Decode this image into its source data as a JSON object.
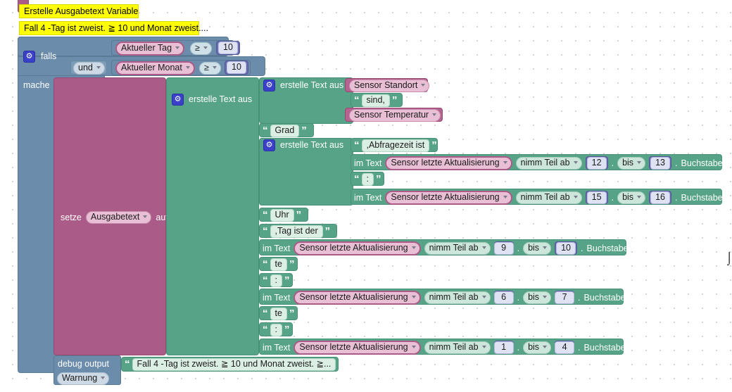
{
  "app": {
    "kind": "blockly-workspace",
    "language": "de",
    "background": "#ffffff",
    "grid_dot_color": "#cfcfcf"
  },
  "colors": {
    "control_blue": "#6b8cab",
    "variable_magenta": "#ab5b87",
    "text_green": "#56a387",
    "math_purple": "#6a6cb0",
    "logic_lightblue": "#7d9cb8",
    "comment_yellow": "#ffff00",
    "gear_icon_blue": "#3a40c8"
  },
  "comments": [
    {
      "text": "Erstelle Ausgabetext Variable"
    },
    {
      "text": "Fall 4 -Tag ist zweist. ≧ 10 und Monat zweist...."
    }
  ],
  "control": {
    "gear_icon": "gear-icon",
    "if_label": "falls",
    "do_label": "mache",
    "and_operator": "und"
  },
  "conditions": [
    {
      "variable": "Aktueller Tag",
      "operator": "≥",
      "value": "10"
    },
    {
      "variable": "Aktueller Monat",
      "operator": "≥",
      "value": "10"
    }
  ],
  "set_variable": {
    "set_label": "setze",
    "variable": "Ausgabetext",
    "to_label": "auf"
  },
  "text_join": {
    "label": "erstelle Text aus",
    "gear_icon": "gear-icon"
  },
  "inner_join_1": {
    "label": "erstelle Text aus",
    "gear_icon": "gear-icon",
    "items": [
      {
        "type": "variable",
        "value": "Sensor Standort"
      },
      {
        "type": "string",
        "value": "sind,"
      },
      {
        "type": "variable",
        "value": "Sensor Temperatur"
      }
    ]
  },
  "literal_grad": {
    "type": "string",
    "value": "Grad"
  },
  "inner_join_2": {
    "label": "erstelle Text aus",
    "gear_icon": "gear-icon",
    "items": [
      {
        "type": "string",
        "value": ",Abfragezeit ist"
      },
      {
        "type": "substring",
        "in_text_label": "im Text",
        "variable": "Sensor letzte Aktualisierung",
        "from_label": "nimm Teil ab",
        "from_value": "12",
        "from_suffix": ".",
        "to_label": "bis",
        "to_value": "13",
        "to_suffix": ".",
        "unit_label": "Buchstabe"
      },
      {
        "type": "string",
        "value": ":"
      },
      {
        "type": "substring",
        "in_text_label": "im Text",
        "variable": "Sensor letzte Aktualisierung",
        "from_label": "nimm Teil ab",
        "from_value": "15",
        "from_suffix": ".",
        "to_label": "bis",
        "to_value": "16",
        "to_suffix": ".",
        "unit_label": "Buchstabe"
      }
    ]
  },
  "outer_items_tail": [
    {
      "type": "string",
      "value": "Uhr"
    },
    {
      "type": "string",
      "value": ",Tag ist der"
    },
    {
      "type": "substring",
      "in_text_label": "im Text",
      "variable": "Sensor letzte Aktualisierung",
      "from_label": "nimm Teil ab",
      "from_value": "9",
      "from_suffix": ".",
      "to_label": "bis",
      "to_value": "10",
      "to_suffix": ".",
      "unit_label": "Buchstabe"
    },
    {
      "type": "string",
      "value": "te"
    },
    {
      "type": "string",
      "value": ":"
    },
    {
      "type": "substring",
      "in_text_label": "im Text",
      "variable": "Sensor letzte Aktualisierung",
      "from_label": "nimm Teil ab",
      "from_value": "6",
      "from_suffix": ".",
      "to_label": "bis",
      "to_value": "7",
      "to_suffix": ".",
      "unit_label": "Buchstabe"
    },
    {
      "type": "string",
      "value": "te"
    },
    {
      "type": "string",
      "value": ":"
    },
    {
      "type": "substring",
      "in_text_label": "im Text",
      "variable": "Sensor letzte Aktualisierung",
      "from_label": "nimm Teil ab",
      "from_value": "1",
      "from_suffix": ".",
      "to_label": "bis",
      "to_value": "4",
      "to_suffix": ".",
      "unit_label": "Buchstabe"
    }
  ],
  "debug": {
    "label": "debug output",
    "level": "Warnung",
    "message": "Fall 4 -Tag ist zweist. ≧ 10 und Monat zweist. ≧..."
  }
}
